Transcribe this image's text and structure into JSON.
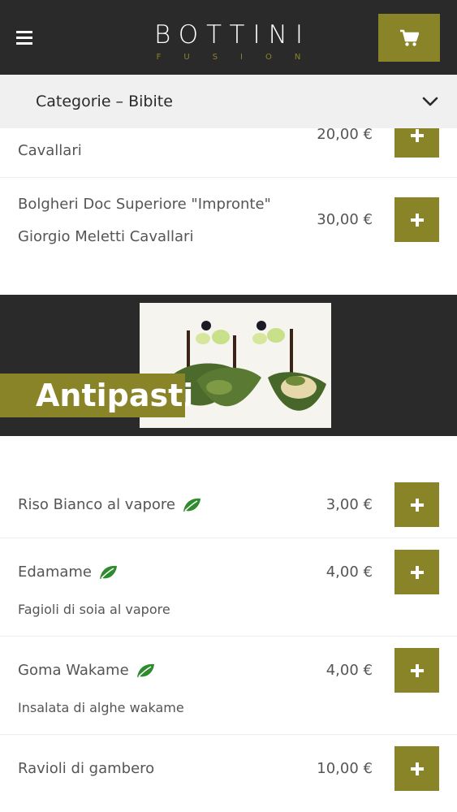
{
  "header": {
    "logo_main": "BOTTINI",
    "logo_sub": "FUSION"
  },
  "category_bar": {
    "title": "Categorie  –  Bibite"
  },
  "wine_items": [
    {
      "name_line1": "",
      "name_line2": "Cavallari",
      "price": "20,00 €"
    },
    {
      "name_line1": "Bolgheri Doc Superiore \"Impronte\"",
      "name_line2": "Giorgio Meletti Cavallari",
      "price": "30,00 €"
    }
  ],
  "section": {
    "title": "Antipasti"
  },
  "antipasti_items": [
    {
      "name": "Riso Bianco al vapore",
      "description": "",
      "price": "3,00 €",
      "vegetarian": true
    },
    {
      "name": "Edamame",
      "description": "Fagioli di soia al vapore",
      "price": "4,00 €",
      "vegetarian": true
    },
    {
      "name": "Goma Wakame",
      "description": "Insalata di alghe wakame",
      "price": "4,00 €",
      "vegetarian": true
    },
    {
      "name": "Ravioli di gambero",
      "description": "",
      "price": "10,00 €",
      "vegetarian": false
    }
  ],
  "colors": {
    "header_bg": "#2b2a2a",
    "accent": "#8a8428",
    "category_bar_bg": "#f0f0f1",
    "leaf_green": "#2e8b2e"
  },
  "icons": {
    "menu": "hamburger-icon",
    "cart": "cart-icon",
    "chevron": "chevron-down-icon",
    "add": "plus-icon",
    "vegetarian": "leaf-icon"
  }
}
